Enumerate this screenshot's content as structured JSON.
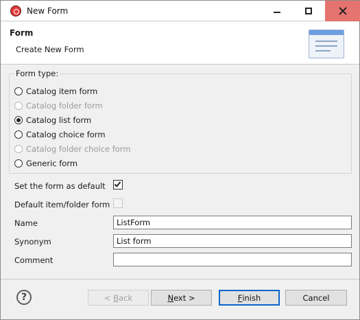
{
  "window": {
    "title": "New Form"
  },
  "header": {
    "title": "Form",
    "subtitle": "Create New Form",
    "icon": "form-page-icon"
  },
  "form_type": {
    "legend": "Form type:",
    "options": [
      {
        "label": "Catalog item form",
        "checked": false,
        "disabled": false
      },
      {
        "label": "Catalog folder form",
        "checked": false,
        "disabled": true
      },
      {
        "label": "Catalog list form",
        "checked": true,
        "disabled": false
      },
      {
        "label": "Catalog choice form",
        "checked": false,
        "disabled": false
      },
      {
        "label": "Catalog folder choice form",
        "checked": false,
        "disabled": true
      },
      {
        "label": "Generic form",
        "checked": false,
        "disabled": false
      }
    ]
  },
  "options": {
    "set_default_label": "Set the form as default",
    "set_default_checked": true,
    "default_item_label": "Default item/folder form",
    "default_item_checked": false
  },
  "fields": {
    "name_label": "Name",
    "name_value": "ListForm",
    "synonym_label": "Synonym",
    "synonym_value": "List form",
    "comment_label": "Comment",
    "comment_value": ""
  },
  "buttons": {
    "help": "?",
    "back_prefix": "< ",
    "back_mnemonic": "B",
    "back_rest": "ack",
    "next_mnemonic": "N",
    "next_rest": "ext >",
    "finish_mnemonic": "F",
    "finish_rest": "inish",
    "cancel": "Cancel"
  }
}
